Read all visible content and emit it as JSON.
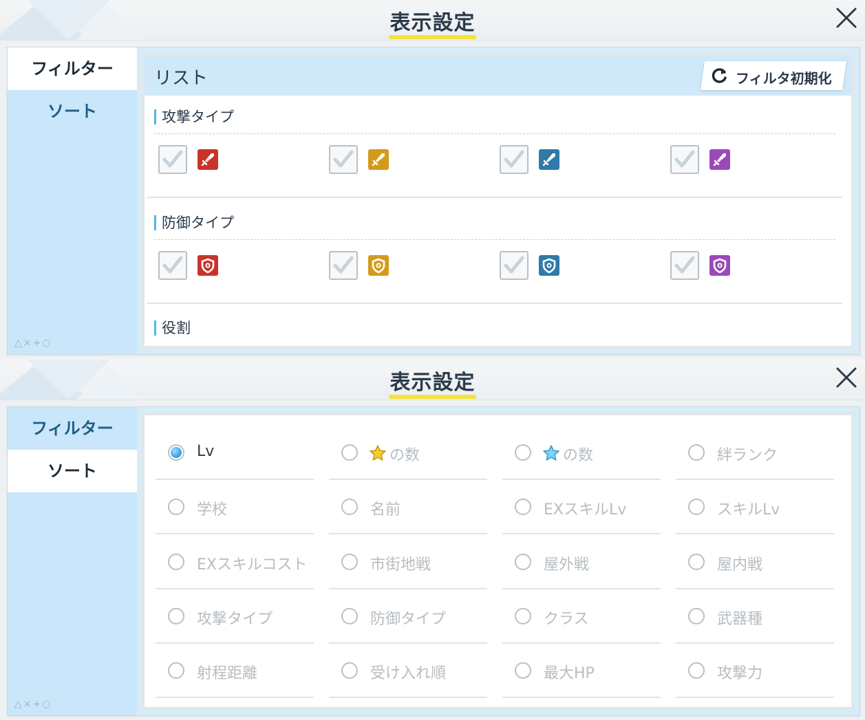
{
  "header": {
    "title": "表示設定"
  },
  "sidebar": {
    "tabs": [
      {
        "label": "フィルター"
      },
      {
        "label": "ソート"
      }
    ],
    "deco": "△×+○"
  },
  "filter": {
    "list_label": "リスト",
    "reset_label": "フィルタ初期化",
    "sections": [
      {
        "title": "攻撃タイプ",
        "items": [
          {
            "checked": true,
            "color": "#c9342a",
            "icon": "sword-icon"
          },
          {
            "checked": true,
            "color": "#d49a1c",
            "icon": "sword-icon"
          },
          {
            "checked": true,
            "color": "#2f7aa8",
            "icon": "sword-icon"
          },
          {
            "checked": true,
            "color": "#9a4ab8",
            "icon": "sword-icon"
          }
        ]
      },
      {
        "title": "防御タイプ",
        "items": [
          {
            "checked": true,
            "color": "#c9342a",
            "icon": "shield-icon"
          },
          {
            "checked": true,
            "color": "#d49a1c",
            "icon": "shield-icon"
          },
          {
            "checked": true,
            "color": "#2f7aa8",
            "icon": "shield-icon"
          },
          {
            "checked": true,
            "color": "#9a4ab8",
            "icon": "shield-icon"
          }
        ]
      },
      {
        "title": "役割",
        "items": []
      }
    ]
  },
  "sort": {
    "options": [
      {
        "label": "Lv",
        "selected": true
      },
      {
        "label": "の数",
        "star": "gold"
      },
      {
        "label": "の数",
        "star": "blue"
      },
      {
        "label": "絆ランク"
      },
      {
        "label": "学校"
      },
      {
        "label": "名前"
      },
      {
        "label": "EXスキルLv"
      },
      {
        "label": "スキルLv"
      },
      {
        "label": "EXスキルコスト"
      },
      {
        "label": "市街地戦"
      },
      {
        "label": "屋外戦"
      },
      {
        "label": "屋内戦"
      },
      {
        "label": "攻撃タイプ"
      },
      {
        "label": "防御タイプ"
      },
      {
        "label": "クラス"
      },
      {
        "label": "武器種"
      },
      {
        "label": "射程距離"
      },
      {
        "label": "受け入れ順"
      },
      {
        "label": "最大HP"
      },
      {
        "label": "攻撃力"
      }
    ]
  }
}
